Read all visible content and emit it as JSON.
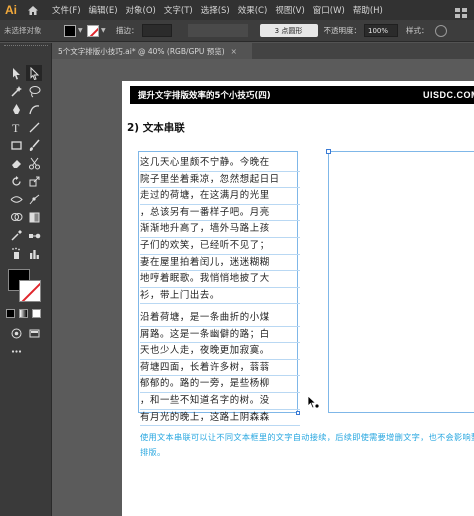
{
  "app": {
    "logo": "Ai"
  },
  "menu": [
    "文件(F)",
    "编辑(E)",
    "对象(O)",
    "文字(T)",
    "选择(S)",
    "效果(C)",
    "视图(V)",
    "窗口(W)",
    "帮助(H)"
  ],
  "control": {
    "selection": "未选择对象",
    "stroke_label": "描边：",
    "brush": "3 点圆形",
    "opacity_label": "不透明度：",
    "opacity": "100%",
    "style_label": "样式："
  },
  "tab": {
    "title": "5个文字排版小技巧.ai* @ 40% (RGB/GPU 预览)",
    "close": "×"
  },
  "artboard": {
    "banner_title": "提升文字排版效率的5个小技巧(四)",
    "banner_brand": "UISDC.COM",
    "heading": "2) 文本串联",
    "para1": [
      "这几天心里颇不宁静。今晚在",
      "院子里坐着乘凉，忽然想起日日",
      "走过的荷塘，在这满月的光里",
      "，总该另有一番样子吧。月亮",
      "渐渐地升高了，墙外马路上孩",
      "子们的欢笑，已经听不见了；",
      "妻在屋里拍着闰儿，迷迷糊糊",
      "地哼着眠歌。我悄悄地披了大",
      "衫，带上门出去。"
    ],
    "para2": [
      "沿着荷塘，是一条曲折的小煤",
      "屑路。这是一条幽僻的路；白",
      "天也少人走，夜晚更加寂寞。",
      "荷塘四面，长着许多树，蓊蓊",
      "郁郁的。路的一旁，是些杨柳",
      "，和一些不知道名字的树。没",
      "有月光的晚上，这路上阴森森"
    ],
    "caption": "使用文本串联可以让不同文本框里的文字自动接续，后续即使需要增删文字，也不会影响整体排版。"
  },
  "colors": {
    "accent_blue": "#28a7e0",
    "frame_blue": "#7fb7e8",
    "stroke_red": "#e0262c"
  }
}
